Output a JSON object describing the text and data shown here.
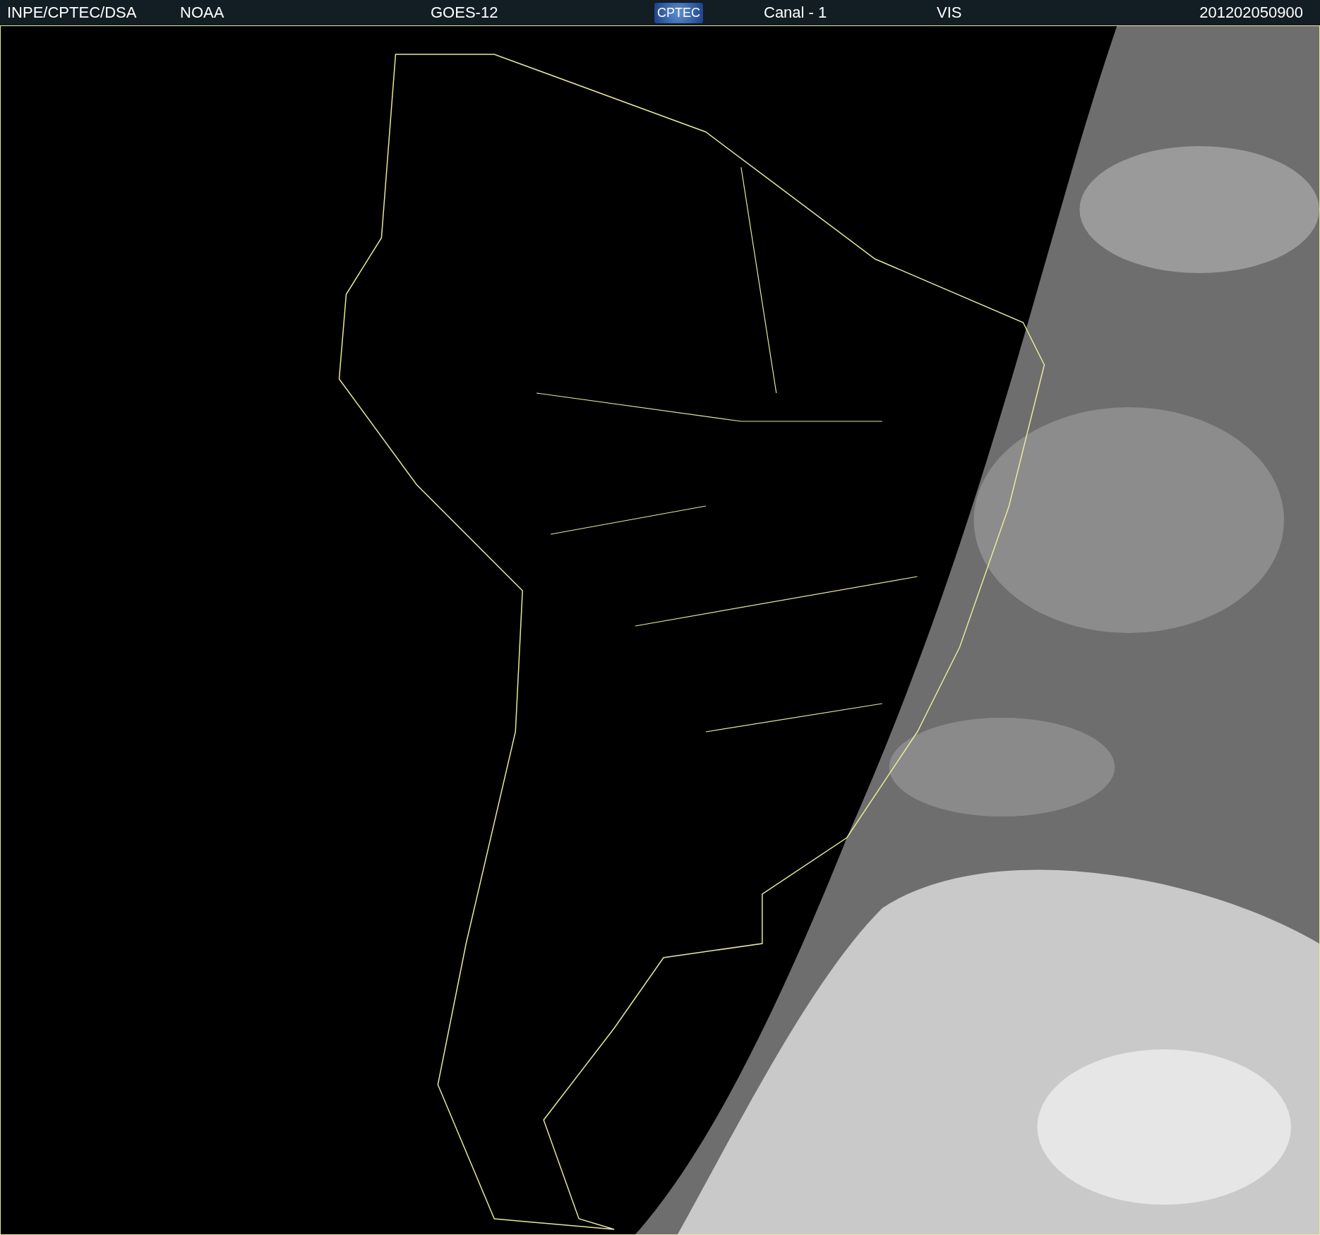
{
  "header": {
    "items": [
      {
        "kind": "text",
        "text": "INPE/CPTEC/DSA"
      },
      {
        "kind": "text",
        "text": "NOAA"
      },
      {
        "kind": "text",
        "text": "GOES-12"
      },
      {
        "kind": "logo",
        "text": "CPTEC"
      },
      {
        "kind": "text",
        "text": "Canal - 1"
      },
      {
        "kind": "text",
        "text": "VIS"
      },
      {
        "kind": "text",
        "text": "201202050900"
      }
    ]
  }
}
